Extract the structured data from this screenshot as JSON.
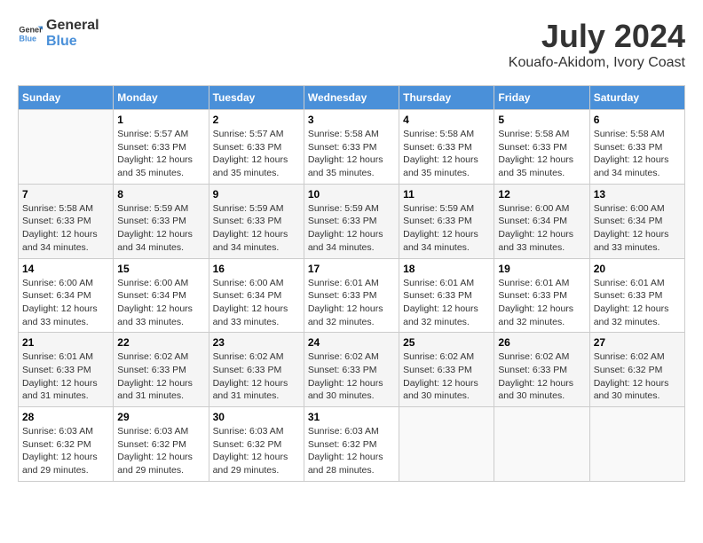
{
  "header": {
    "logo_line1": "General",
    "logo_line2": "Blue",
    "month_year": "July 2024",
    "location": "Kouafo-Akidom, Ivory Coast"
  },
  "calendar": {
    "days_of_week": [
      "Sunday",
      "Monday",
      "Tuesday",
      "Wednesday",
      "Thursday",
      "Friday",
      "Saturday"
    ],
    "weeks": [
      [
        {
          "day": "",
          "info": ""
        },
        {
          "day": "1",
          "info": "Sunrise: 5:57 AM\nSunset: 6:33 PM\nDaylight: 12 hours\nand 35 minutes."
        },
        {
          "day": "2",
          "info": "Sunrise: 5:57 AM\nSunset: 6:33 PM\nDaylight: 12 hours\nand 35 minutes."
        },
        {
          "day": "3",
          "info": "Sunrise: 5:58 AM\nSunset: 6:33 PM\nDaylight: 12 hours\nand 35 minutes."
        },
        {
          "day": "4",
          "info": "Sunrise: 5:58 AM\nSunset: 6:33 PM\nDaylight: 12 hours\nand 35 minutes."
        },
        {
          "day": "5",
          "info": "Sunrise: 5:58 AM\nSunset: 6:33 PM\nDaylight: 12 hours\nand 35 minutes."
        },
        {
          "day": "6",
          "info": "Sunrise: 5:58 AM\nSunset: 6:33 PM\nDaylight: 12 hours\nand 34 minutes."
        }
      ],
      [
        {
          "day": "7",
          "info": "Sunrise: 5:58 AM\nSunset: 6:33 PM\nDaylight: 12 hours\nand 34 minutes."
        },
        {
          "day": "8",
          "info": "Sunrise: 5:59 AM\nSunset: 6:33 PM\nDaylight: 12 hours\nand 34 minutes."
        },
        {
          "day": "9",
          "info": "Sunrise: 5:59 AM\nSunset: 6:33 PM\nDaylight: 12 hours\nand 34 minutes."
        },
        {
          "day": "10",
          "info": "Sunrise: 5:59 AM\nSunset: 6:33 PM\nDaylight: 12 hours\nand 34 minutes."
        },
        {
          "day": "11",
          "info": "Sunrise: 5:59 AM\nSunset: 6:33 PM\nDaylight: 12 hours\nand 34 minutes."
        },
        {
          "day": "12",
          "info": "Sunrise: 6:00 AM\nSunset: 6:34 PM\nDaylight: 12 hours\nand 33 minutes."
        },
        {
          "day": "13",
          "info": "Sunrise: 6:00 AM\nSunset: 6:34 PM\nDaylight: 12 hours\nand 33 minutes."
        }
      ],
      [
        {
          "day": "14",
          "info": "Sunrise: 6:00 AM\nSunset: 6:34 PM\nDaylight: 12 hours\nand 33 minutes."
        },
        {
          "day": "15",
          "info": "Sunrise: 6:00 AM\nSunset: 6:34 PM\nDaylight: 12 hours\nand 33 minutes."
        },
        {
          "day": "16",
          "info": "Sunrise: 6:00 AM\nSunset: 6:34 PM\nDaylight: 12 hours\nand 33 minutes."
        },
        {
          "day": "17",
          "info": "Sunrise: 6:01 AM\nSunset: 6:33 PM\nDaylight: 12 hours\nand 32 minutes."
        },
        {
          "day": "18",
          "info": "Sunrise: 6:01 AM\nSunset: 6:33 PM\nDaylight: 12 hours\nand 32 minutes."
        },
        {
          "day": "19",
          "info": "Sunrise: 6:01 AM\nSunset: 6:33 PM\nDaylight: 12 hours\nand 32 minutes."
        },
        {
          "day": "20",
          "info": "Sunrise: 6:01 AM\nSunset: 6:33 PM\nDaylight: 12 hours\nand 32 minutes."
        }
      ],
      [
        {
          "day": "21",
          "info": "Sunrise: 6:01 AM\nSunset: 6:33 PM\nDaylight: 12 hours\nand 31 minutes."
        },
        {
          "day": "22",
          "info": "Sunrise: 6:02 AM\nSunset: 6:33 PM\nDaylight: 12 hours\nand 31 minutes."
        },
        {
          "day": "23",
          "info": "Sunrise: 6:02 AM\nSunset: 6:33 PM\nDaylight: 12 hours\nand 31 minutes."
        },
        {
          "day": "24",
          "info": "Sunrise: 6:02 AM\nSunset: 6:33 PM\nDaylight: 12 hours\nand 30 minutes."
        },
        {
          "day": "25",
          "info": "Sunrise: 6:02 AM\nSunset: 6:33 PM\nDaylight: 12 hours\nand 30 minutes."
        },
        {
          "day": "26",
          "info": "Sunrise: 6:02 AM\nSunset: 6:33 PM\nDaylight: 12 hours\nand 30 minutes."
        },
        {
          "day": "27",
          "info": "Sunrise: 6:02 AM\nSunset: 6:32 PM\nDaylight: 12 hours\nand 30 minutes."
        }
      ],
      [
        {
          "day": "28",
          "info": "Sunrise: 6:03 AM\nSunset: 6:32 PM\nDaylight: 12 hours\nand 29 minutes."
        },
        {
          "day": "29",
          "info": "Sunrise: 6:03 AM\nSunset: 6:32 PM\nDaylight: 12 hours\nand 29 minutes."
        },
        {
          "day": "30",
          "info": "Sunrise: 6:03 AM\nSunset: 6:32 PM\nDaylight: 12 hours\nand 29 minutes."
        },
        {
          "day": "31",
          "info": "Sunrise: 6:03 AM\nSunset: 6:32 PM\nDaylight: 12 hours\nand 28 minutes."
        },
        {
          "day": "",
          "info": ""
        },
        {
          "day": "",
          "info": ""
        },
        {
          "day": "",
          "info": ""
        }
      ]
    ]
  }
}
